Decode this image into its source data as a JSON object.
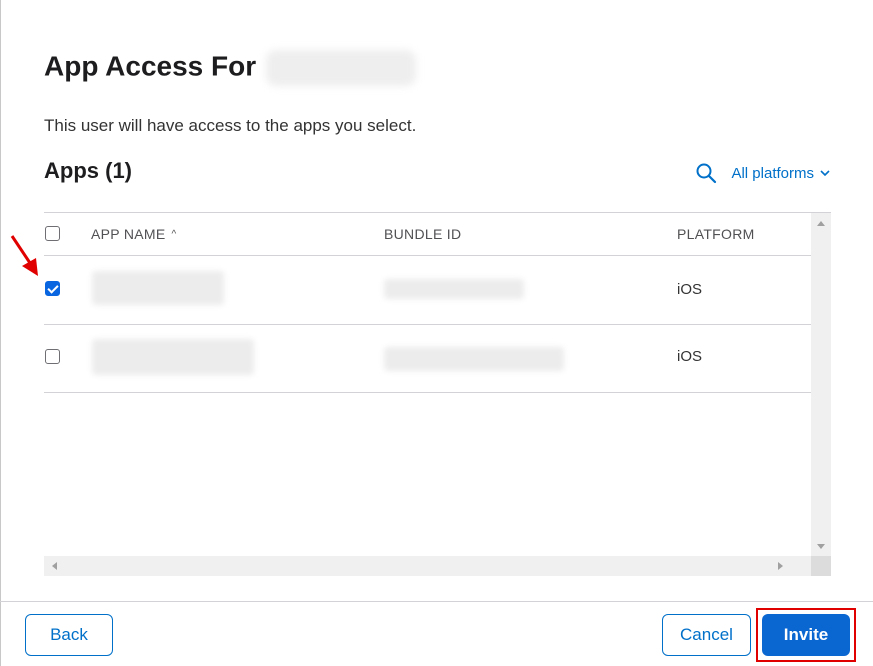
{
  "dialog": {
    "title_prefix": "App Access For",
    "description": "This user will have access to the apps you select.",
    "apps_heading": "Apps (1)",
    "platform_filter": {
      "label": "All platforms",
      "icon": "search-icon"
    }
  },
  "table": {
    "columns": [
      "APP NAME",
      "BUNDLE ID",
      "PLATFORM"
    ],
    "sort_indicator": "^",
    "rows": [
      {
        "selected": true,
        "platform": "iOS"
      },
      {
        "selected": false,
        "platform": "iOS"
      }
    ]
  },
  "footer": {
    "back_label": "Back",
    "cancel_label": "Cancel",
    "invite_label": "Invite"
  },
  "colors": {
    "accent": "#0070c9",
    "primary_button": "#0a66d0",
    "annotation": "#e00000"
  }
}
